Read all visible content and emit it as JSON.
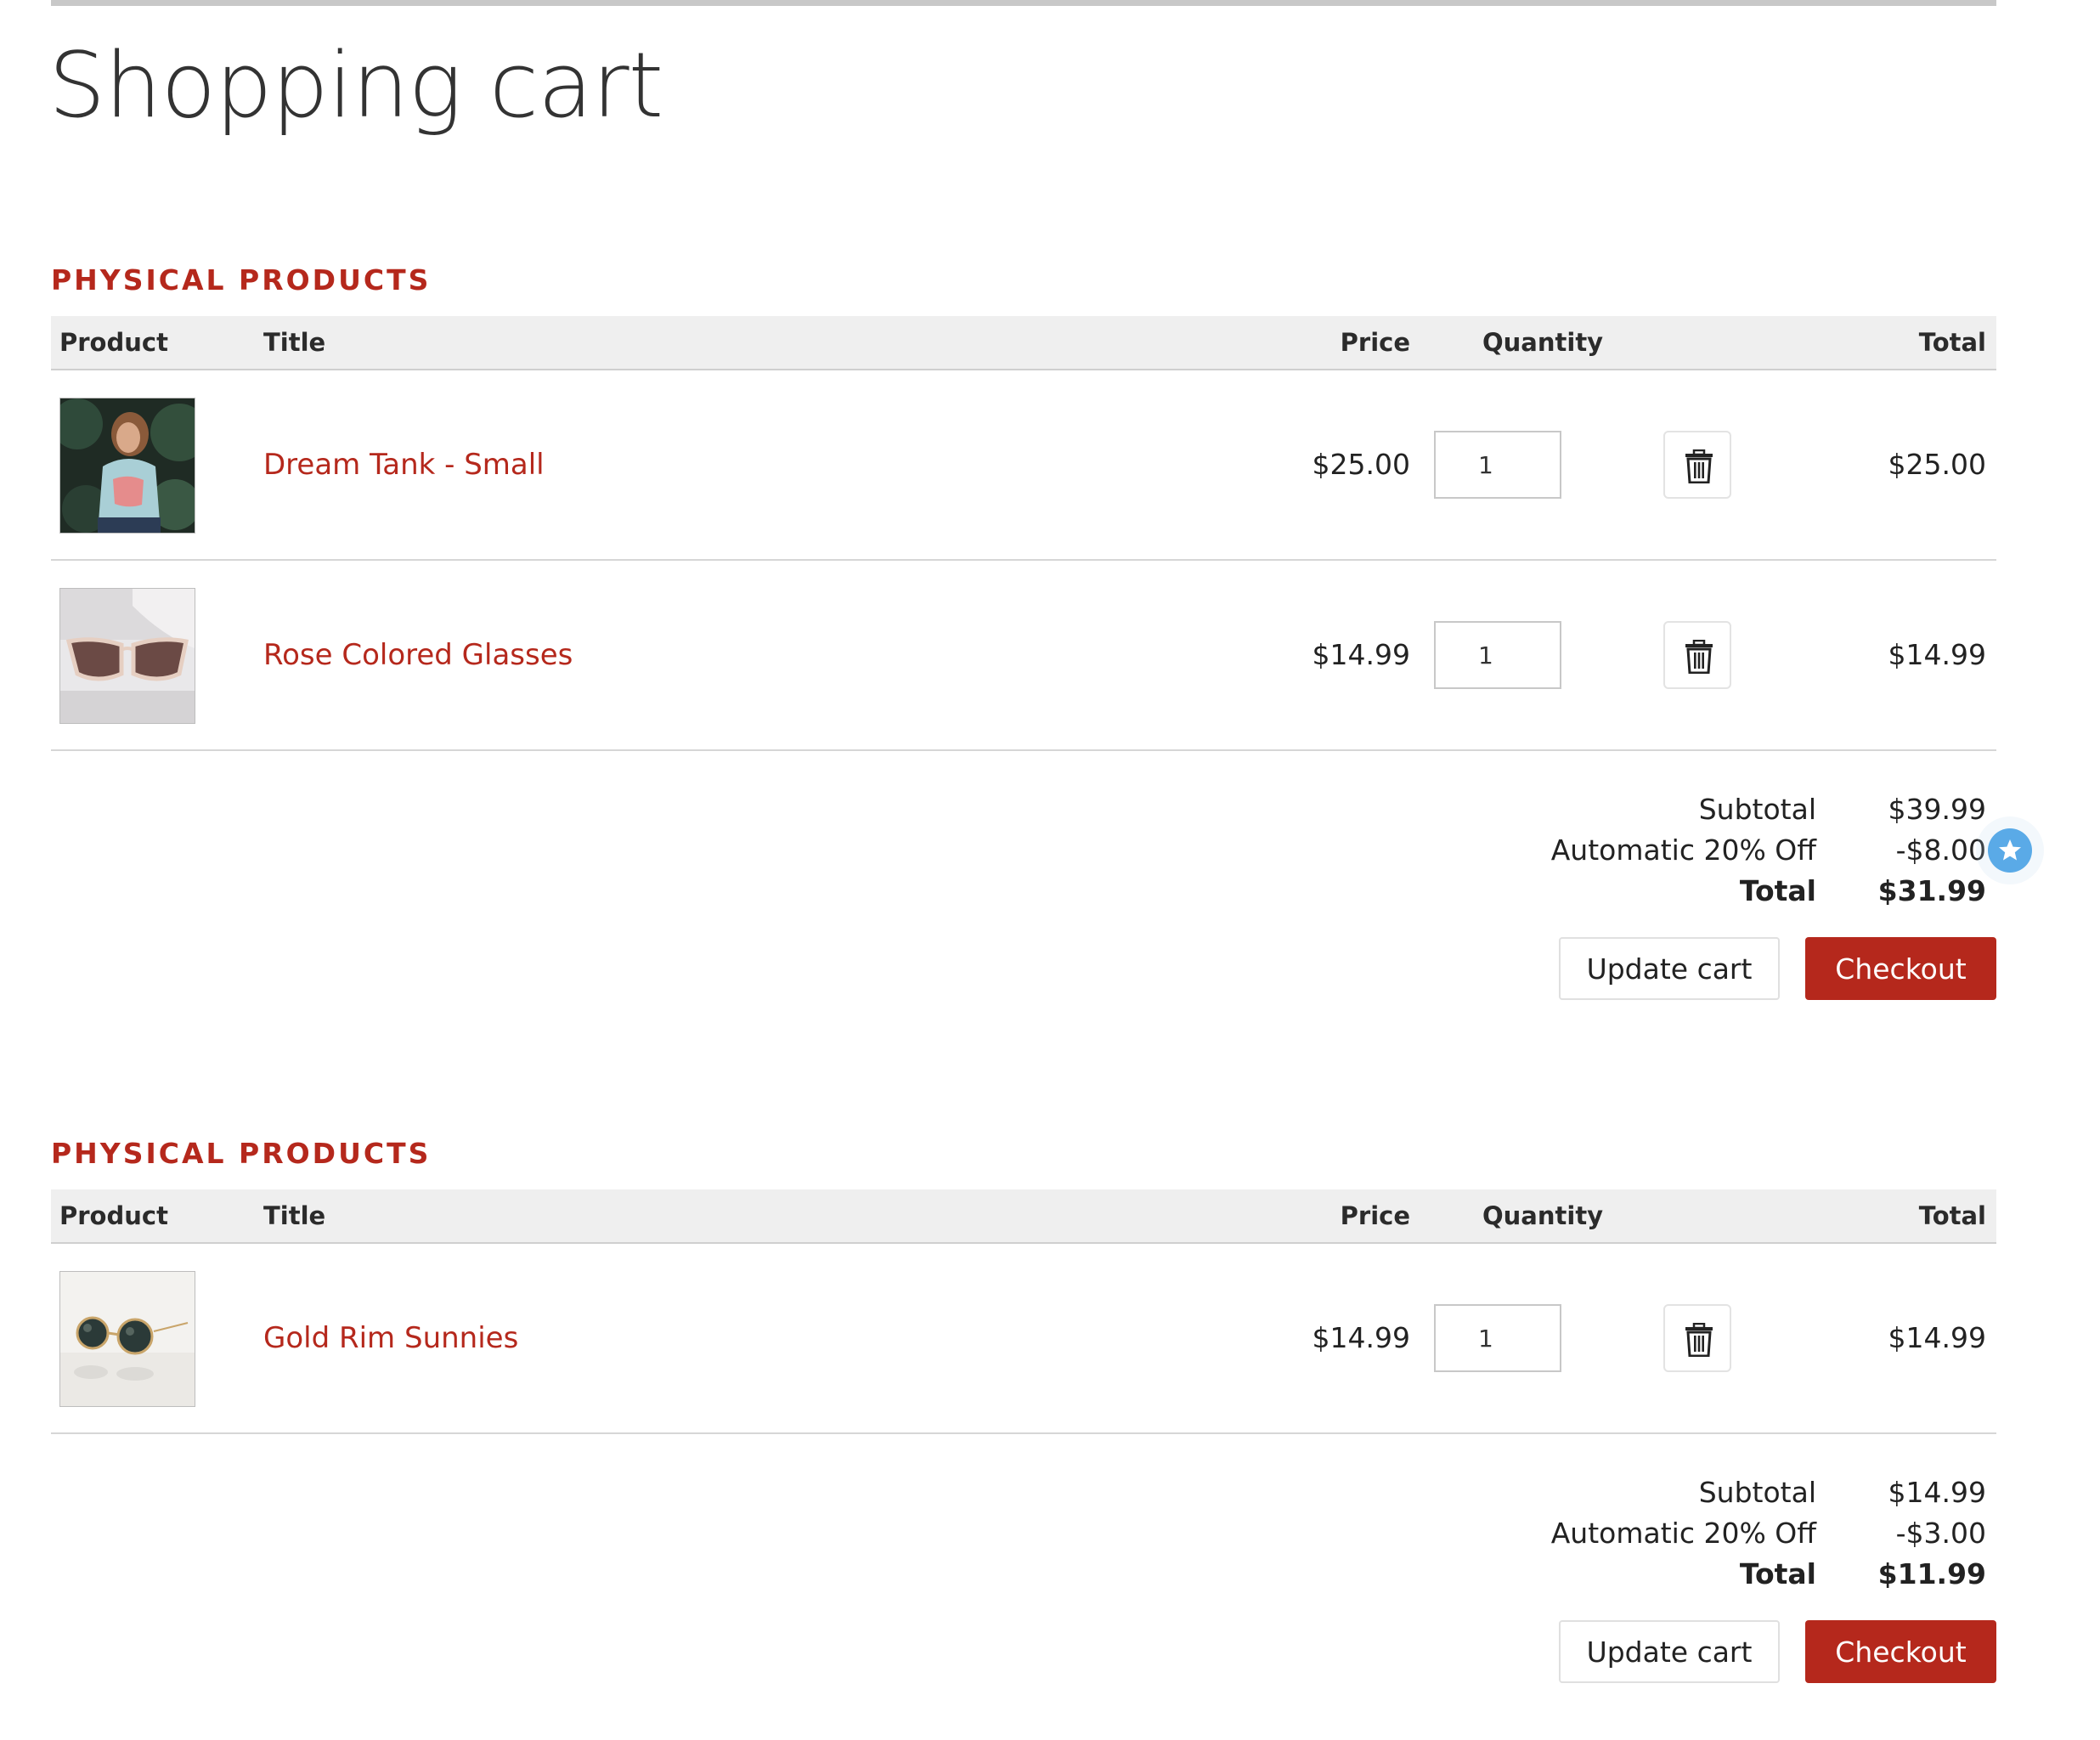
{
  "page": {
    "title": "Shopping cart"
  },
  "colors": {
    "accent": "#b5281c",
    "header_bg": "#efefef",
    "badge": "#5aaae7"
  },
  "table_headers": {
    "product": "Product",
    "title": "Title",
    "price": "Price",
    "quantity": "Quantity",
    "total": "Total"
  },
  "carts": [
    {
      "heading": "PHYSICAL PRODUCTS",
      "items": [
        {
          "image": "tank-top-photo",
          "title": "Dream Tank - Small",
          "price": "$25.00",
          "quantity": "1",
          "total": "$25.00"
        },
        {
          "image": "glasses-photo",
          "title": "Rose Colored Glasses",
          "price": "$14.99",
          "quantity": "1",
          "total": "$14.99"
        }
      ],
      "summary": {
        "subtotal_label": "Subtotal",
        "subtotal": "$39.99",
        "discount_label": "Automatic 20% Off",
        "discount": "-$8.00",
        "total_label": "Total",
        "total": "$31.99"
      },
      "actions": {
        "update": "Update cart",
        "checkout": "Checkout"
      }
    },
    {
      "heading": "PHYSICAL PRODUCTS",
      "items": [
        {
          "image": "sunglasses-photo",
          "title": "Gold Rim Sunnies",
          "price": "$14.99",
          "quantity": "1",
          "total": "$14.99"
        }
      ],
      "summary": {
        "subtotal_label": "Subtotal",
        "subtotal": "$14.99",
        "discount_label": "Automatic 20% Off",
        "discount": "-$3.00",
        "total_label": "Total",
        "total": "$11.99"
      },
      "actions": {
        "update": "Update cart",
        "checkout": "Checkout"
      }
    }
  ],
  "icons": {
    "delete": "trash-icon",
    "badge": "star-icon"
  }
}
